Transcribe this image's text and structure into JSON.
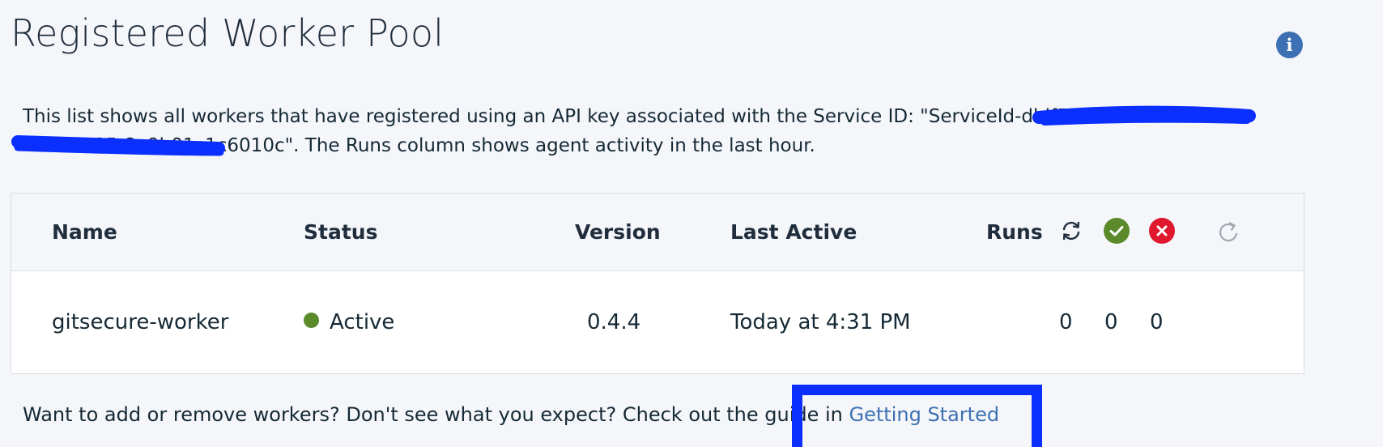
{
  "page": {
    "title": "Registered Worker Pool"
  },
  "header": {
    "info_icon": "info-icon",
    "info_glyph": "i"
  },
  "description": {
    "part1": "This list shows all workers that have registered using an API key associated with the Service ID: \"ServiceId-d",
    "redacted1": "ldf53-7a-b7f-45bb",
    "line2_redacted": "b595-8a9b01c1c6010",
    "part2": "c\". The Runs column shows agent activity in the last hour."
  },
  "table": {
    "columns": {
      "name": "Name",
      "status": "Status",
      "version": "Version",
      "last_active": "Last Active",
      "runs": "Runs"
    },
    "run_icons": [
      "sync-icon",
      "success-icon",
      "error-icon",
      "refresh-icon"
    ],
    "colors": {
      "success": "#5a8a2a",
      "error": "#e0182d",
      "refresh": "#a0a8b0",
      "sync": "#1f2d3d"
    },
    "rows": [
      {
        "name": "gitsecure-worker",
        "status": "Active",
        "version": "0.4.4",
        "last_active": "Today at 4:31 PM",
        "runs_in_progress": "0",
        "runs_succeeded": "0",
        "runs_failed": "0"
      }
    ]
  },
  "footer": {
    "text": "Want to add or remove workers? Don't see what you expect? Check out the guide in ",
    "link_label": "Getting Started"
  }
}
